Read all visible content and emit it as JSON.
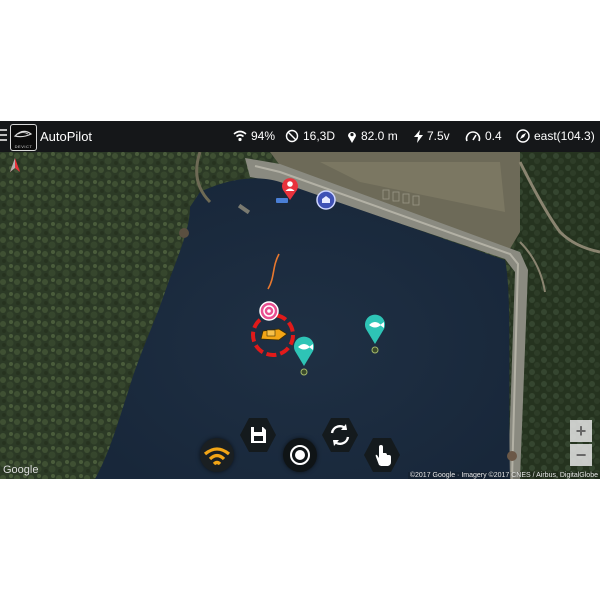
{
  "app": {
    "title": "AutoPilot",
    "logo_text": "DEVICT"
  },
  "status": {
    "wifi": "94%",
    "gps": "16,3D",
    "distance": "82.0 m",
    "voltage": "7.5v",
    "speed": "0.4",
    "heading": "east(104.3)"
  },
  "map": {
    "attribution": "©2017 Google · Imagery ©2017 CNES / Airbus, DigitalGlobe",
    "google_logo": "Google",
    "zoom_in": "+",
    "zoom_out": "−"
  },
  "colors": {
    "topbar": "#151719",
    "water": "#1d2c3d",
    "fish_marker": "#2ec4b6",
    "home_marker": "#e8323c",
    "boat_ring": "#e11a1a",
    "boat": "#f2a516",
    "target_marker": "#e94f91",
    "wifi_button": "#f2a516"
  },
  "icons": [
    "menu-icon",
    "wifi-icon",
    "satellite-icon",
    "location-pin-icon",
    "lightning-icon",
    "speedometer-icon",
    "compass-icon",
    "save-icon",
    "refresh-icon",
    "hand-icon",
    "record-icon",
    "signal-icon",
    "fish-icon",
    "home-icon",
    "boat-icon",
    "north-arrow-icon"
  ]
}
